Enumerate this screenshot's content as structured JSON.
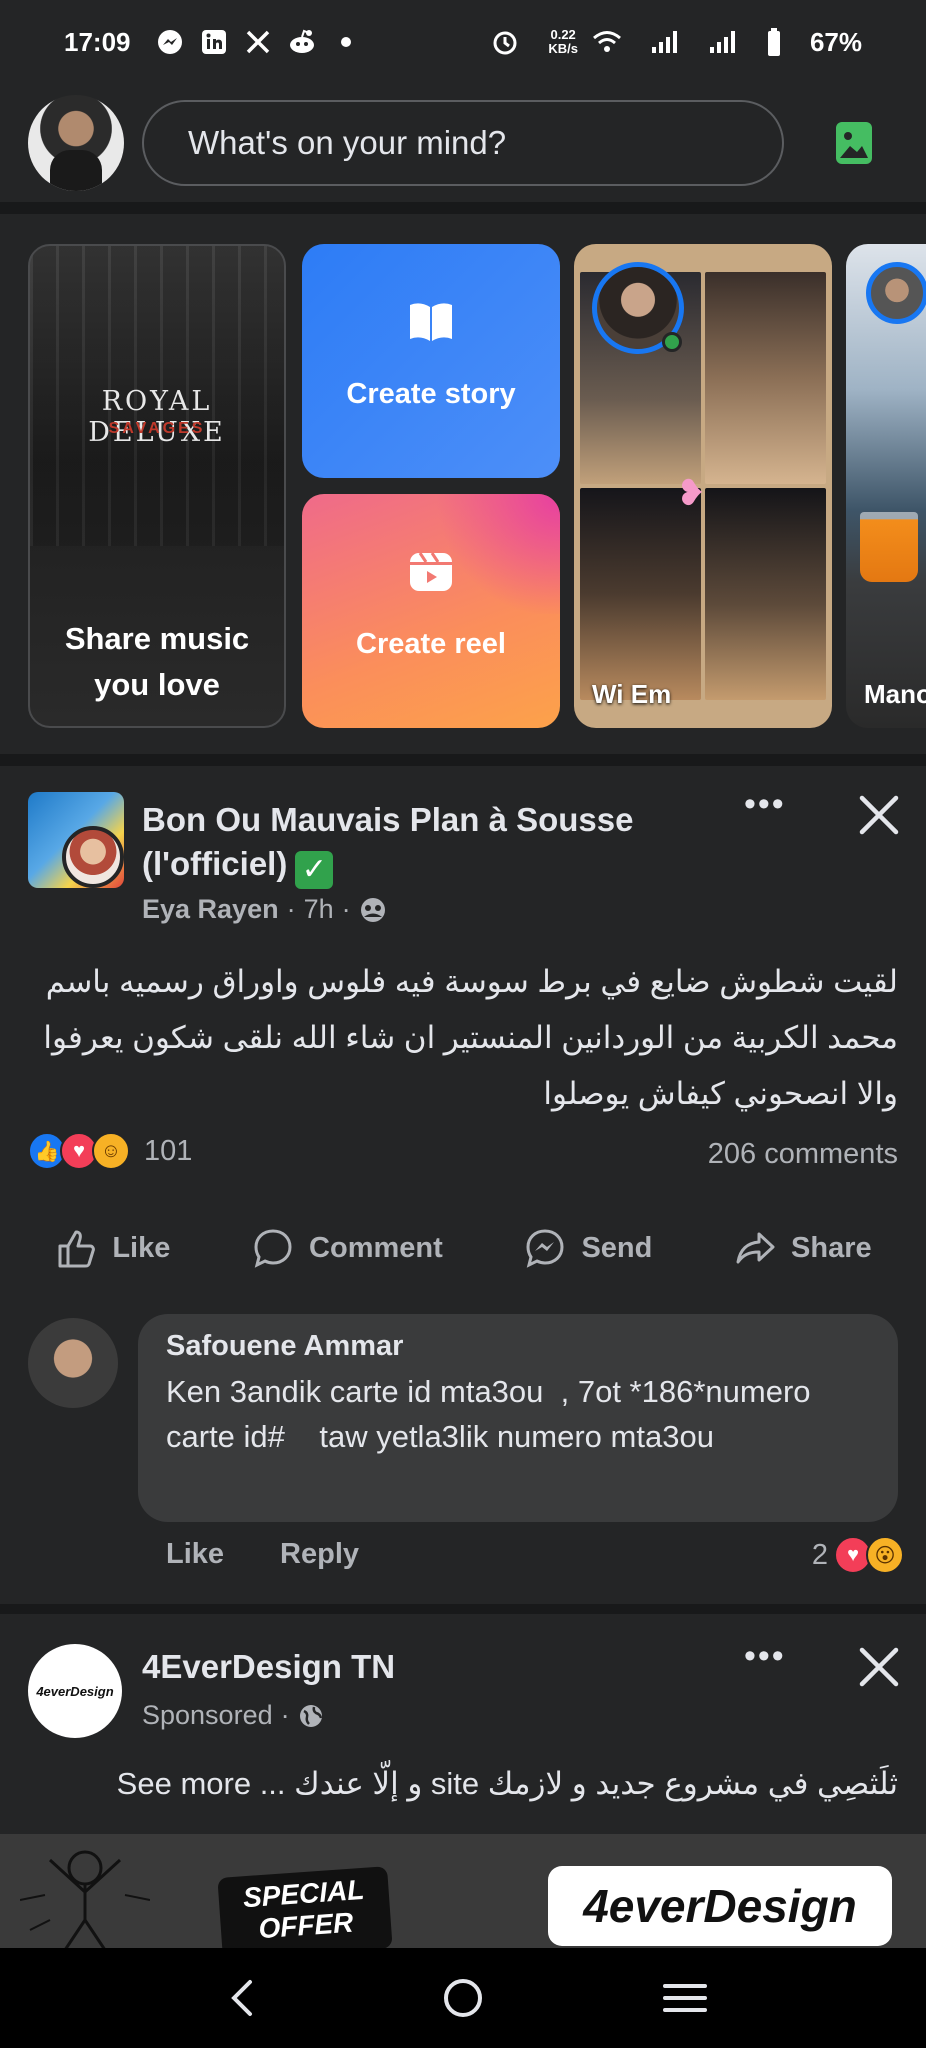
{
  "status_bar": {
    "time": "17:09",
    "net_speed_value": "0.22",
    "net_speed_unit": "KB/s",
    "battery": "67%",
    "notification_icons": [
      "messenger-icon",
      "linkedin-icon",
      "x-icon",
      "reddit-icon",
      "dot-icon"
    ]
  },
  "composer": {
    "placeholder": "What's on your mind?"
  },
  "stories": {
    "music": {
      "band": "ROYAL DELUXE",
      "album": "SAVAGES",
      "label_line1": "Share music",
      "label_line2": "you love"
    },
    "create_story": "Create story",
    "create_reel": "Create reel",
    "friend1": {
      "name": "Wi Em"
    },
    "friend2": {
      "name": "Mano"
    }
  },
  "post": {
    "page_name": "Bon Ou Mauvais Plan à Sousse (l'officiel)",
    "author": "Eya Rayen",
    "time": "7h",
    "text": "لقيت شطوش ضايع  في برط سوسة فيه فلوس واوراق رسميه باسم محمد الكربية من الوردانين المنستير  ان شاء الله نلقى شكون يعرفوا والا انصحوني  كيفاش يوصلوا",
    "reaction_count": "101",
    "comments_count": "206 comments",
    "actions": {
      "like": "Like",
      "comment": "Comment",
      "send": "Send",
      "share": "Share"
    },
    "comment": {
      "author": "Safouene Ammar",
      "text": "Ken 3andik carte id mta3ou  , 7ot *186*numero carte id#    taw yetla3lik numero mta3ou",
      "like": "Like",
      "reply": "Reply",
      "reaction_count": "2"
    }
  },
  "sponsored": {
    "page_name": "4EverDesign TN",
    "label": "Sponsored",
    "text": "ثلَثصِي في مشروع جديد و لازمك site و إلّا عندك ... See more",
    "ad_offer": "SPECIAL OFFER",
    "ad_logo": "4everDesign",
    "avatar_logo": "4everDesign"
  },
  "colors": {
    "background": "#242526",
    "divider": "#18191a",
    "accent_blue": "#1877f2",
    "secondary_text": "#b0b3b8",
    "photo_icon_green": "#45bd62"
  }
}
